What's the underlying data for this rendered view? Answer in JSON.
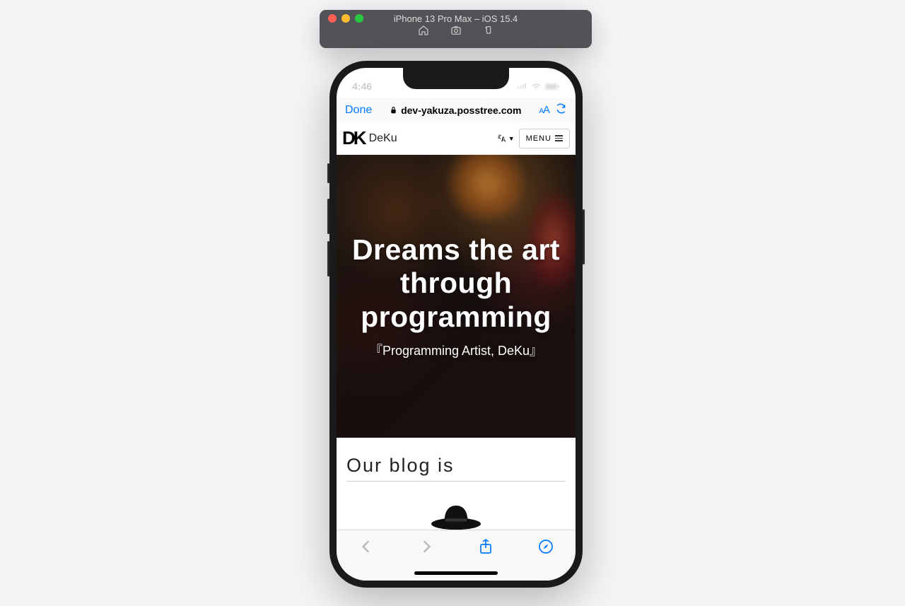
{
  "simulator": {
    "title": "iPhone 13 Pro Max – iOS 15.4"
  },
  "statusbar": {
    "time": "4:46"
  },
  "safari": {
    "done_label": "Done",
    "url": "dev-yakuza.posstree.com",
    "text_size_label": "AA"
  },
  "site": {
    "logo_mark": "DK",
    "logo_text": "DeKu",
    "menu_label": "MENU"
  },
  "hero": {
    "title": "Dreams the art through programming",
    "subtitle": "『Programming Artist, DeKu』"
  },
  "blog": {
    "heading": "Our blog is"
  }
}
